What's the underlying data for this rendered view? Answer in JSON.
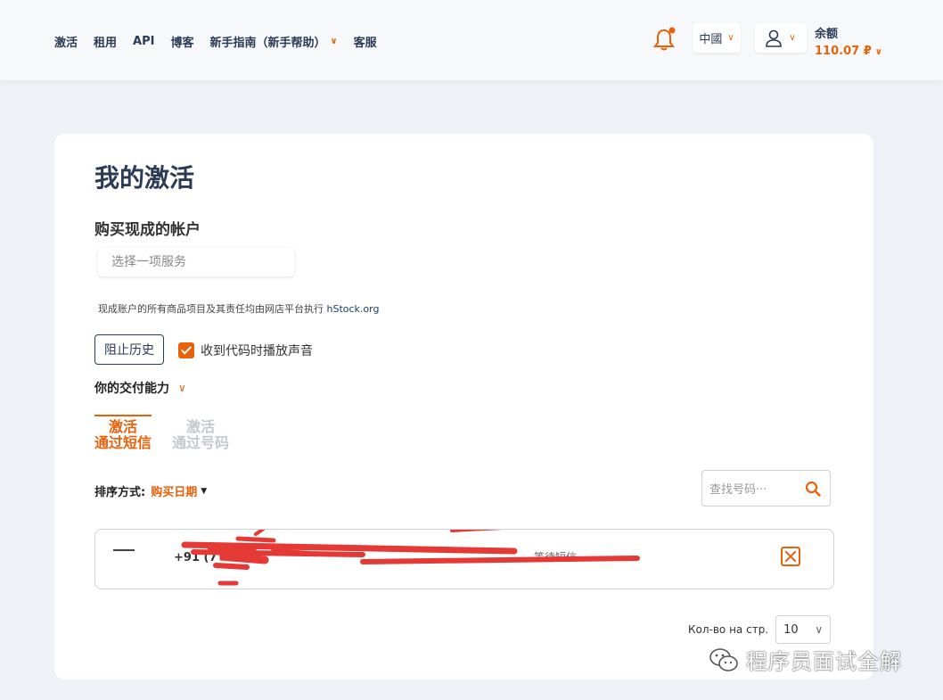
{
  "nav": {
    "items": [
      {
        "label": "激活"
      },
      {
        "label": "租用"
      },
      {
        "label": "API"
      },
      {
        "label": "博客"
      },
      {
        "label": "新手指南（新手帮助）",
        "has_dropdown": true
      },
      {
        "label": "客服"
      }
    ]
  },
  "header": {
    "language": "中國",
    "balance_label": "余额",
    "balance_value": "110.07 ₽"
  },
  "main": {
    "title": "我的激活",
    "buy_section_title": "购买现成的帐户",
    "service_placeholder": "选择一项服务",
    "notice_text": "现成账户的所有商品项目及其责任均由网店平台执行 ",
    "notice_link": "hStock.org",
    "history_button": "阻止历史",
    "sound_label": "收到代码时播放声音",
    "sound_checked": true,
    "capacity_label": "你的交付能力",
    "tabs": [
      {
        "line1": "激活",
        "line2": "通过短信",
        "active": true
      },
      {
        "line1": "激活",
        "line2": "通过号码",
        "active": false
      }
    ],
    "sort_label": "排序方式:",
    "sort_value": "购买日期",
    "search_placeholder": "查找号码···",
    "activations": [
      {
        "service": "—",
        "phone": "+91 (7",
        "status": "等待短信"
      }
    ],
    "per_page_label": "Кол-во на стр.",
    "per_page_value": "10"
  },
  "watermark": "程序员面试全解",
  "colors": {
    "accent": "#e8620c",
    "text_dark": "#2b3a55",
    "background": "#eef1f5",
    "scribble": "#e53935"
  }
}
